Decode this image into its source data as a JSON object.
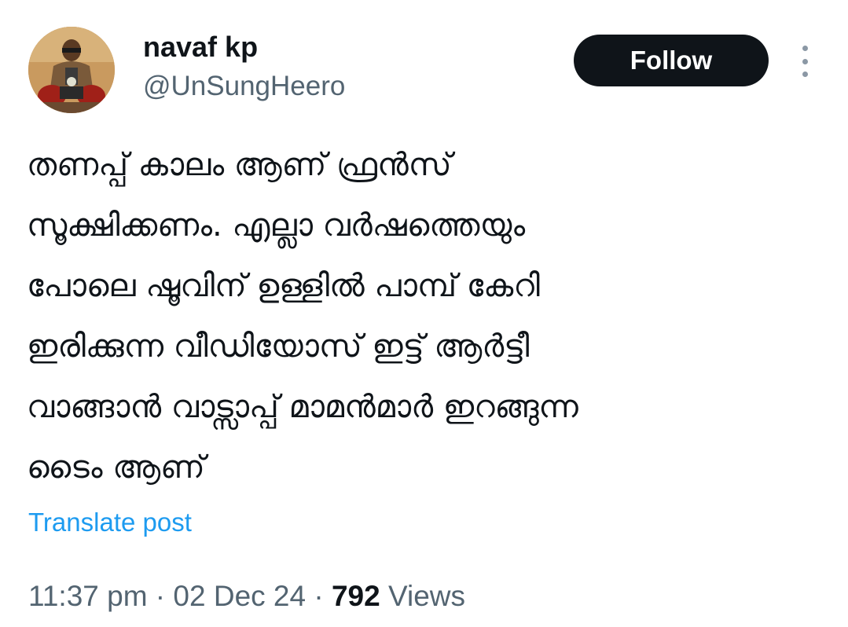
{
  "author": {
    "display_name": "navaf kp",
    "handle": "@UnSungHeero"
  },
  "actions": {
    "follow_label": "Follow",
    "more_icon": "more-vertical-icon"
  },
  "tweet": {
    "lines": [
      "തണപ്പ് കാലം ആണ് ഫ്രൻസ്",
      "സൂക്ഷിക്കണം. എല്ലാ വർഷത്തെയും",
      "പോലെ ഷൂവിന് ഉള്ളിൽ പാമ്പ് കേറി",
      "ഇരിക്കുന്ന വീഡിയോസ് ഇട്ട് ആർട്ടീ",
      "വാങ്ങാൻ വാട്സാപ്പ് മാമൻമാർ ഇറങ്ങുന്ന",
      "ടൈം ആണ്"
    ],
    "translate_label": "Translate post"
  },
  "meta": {
    "time": "11:37 pm",
    "separator": " · ",
    "date": "02 Dec 24",
    "views_count": "792",
    "views_label": " Views"
  },
  "colors": {
    "text_primary": "#0f1419",
    "text_secondary": "#536471",
    "link": "#1d9bf0",
    "button_bg": "#0f1419"
  }
}
